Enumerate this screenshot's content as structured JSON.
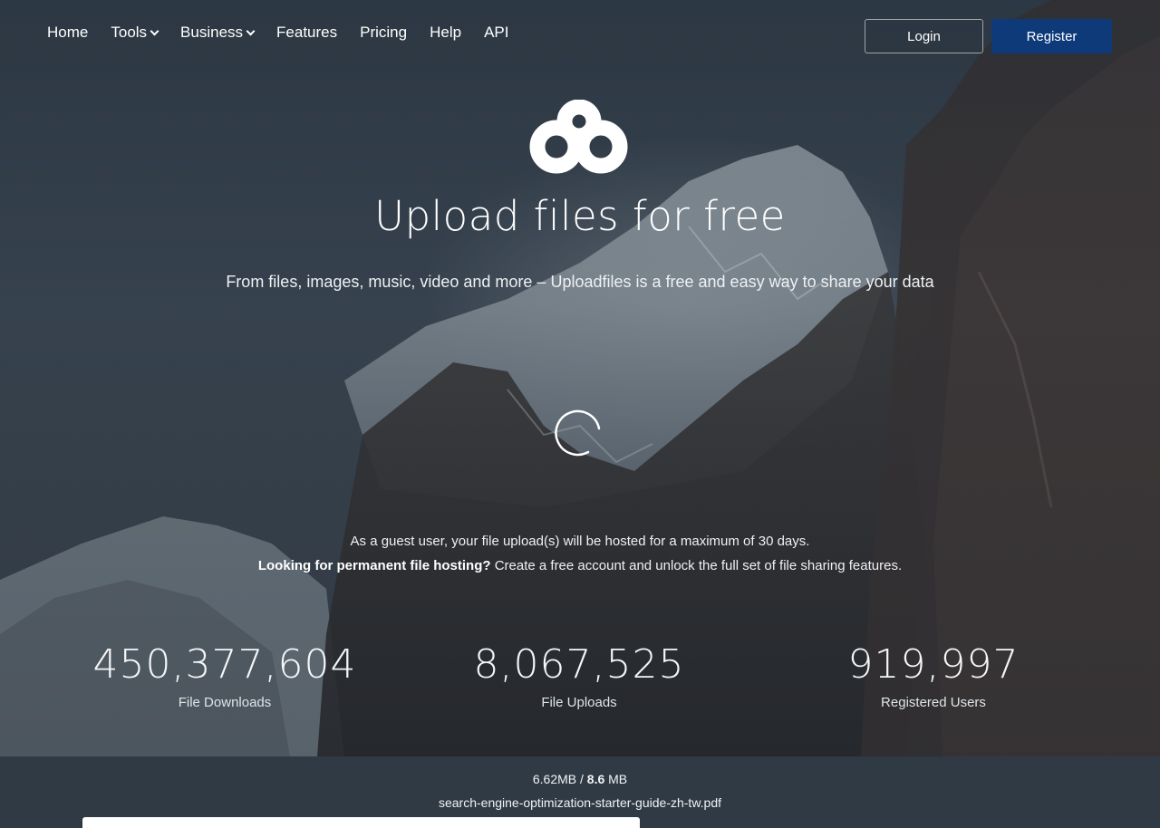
{
  "nav": {
    "items": [
      {
        "label": "Home",
        "dropdown": false
      },
      {
        "label": "Tools",
        "dropdown": true
      },
      {
        "label": "Business",
        "dropdown": true
      },
      {
        "label": "Features",
        "dropdown": false
      },
      {
        "label": "Pricing",
        "dropdown": false
      },
      {
        "label": "Help",
        "dropdown": false
      },
      {
        "label": "API",
        "dropdown": false
      }
    ],
    "login_label": "Login",
    "register_label": "Register"
  },
  "hero": {
    "logo_icon": "uploadfiles-logo-icon",
    "title": "Upload files for free",
    "subtitle": "From files, images, music, video and more – Uploadfiles is a free and easy way to share your data",
    "spinner_icon": "loading-spinner-icon"
  },
  "notice": {
    "guest": "As a guest user, your file upload(s) will be hosted for a maximum of 30 days.",
    "permanent_bold": "Looking for permanent file hosting?",
    "permanent_rest": " Create a free account and unlock the full set of file sharing features."
  },
  "stats": [
    {
      "value": "450,377,604",
      "label": "File Downloads"
    },
    {
      "value": "8,067,525",
      "label": "File Uploads"
    },
    {
      "value": "919,997",
      "label": "Registered Users"
    }
  ],
  "upload": {
    "uploaded": "6.62MB",
    "separator": " / ",
    "total_value": "8.6",
    "total_unit": " MB",
    "filename": "search-engine-optimization-starter-guide-zh-tw.pdf",
    "progress_fraction": 0.56
  },
  "colors": {
    "register_bg": "#0e3a7a",
    "bottom_bar": "#303a45"
  }
}
